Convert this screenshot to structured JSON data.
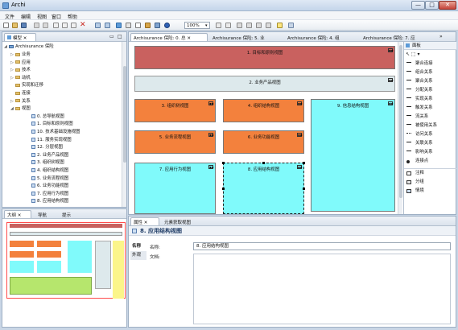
{
  "window": {
    "title": "Archi",
    "min_label": "—",
    "max_label": "□",
    "close_label": "✕"
  },
  "menu": [
    "文件",
    "编辑",
    "视图",
    "窗口",
    "帮助"
  ],
  "toolbar": {
    "zoom": "100%"
  },
  "model_tree": {
    "tab": "模型",
    "root": "Archisurance 保险",
    "folders": [
      "业务",
      "应用",
      "技术",
      "动机",
      "实现和迁移",
      "连接",
      "关系",
      "视图"
    ],
    "views": [
      "0. 总导航视图",
      "1. 目标和原则视图",
      "10. 技术基础设施视图",
      "11. 服务实现视图",
      "12. 分层视图",
      "2. 业务产品视图",
      "3. 组织树视图",
      "4. 组织结构视图",
      "5. 业务流程视图",
      "6. 业务功能视图",
      "7. 应用行为视图",
      "8. 应用结构视图"
    ]
  },
  "editor": {
    "tabs": [
      "Archisurance 保险: 0. 总",
      "Archisurance 保险: 5. 业",
      "Archisurance 保险: 4. 组",
      "Archisurance 保险: 7. 应"
    ],
    "diagram": {
      "n1": "1. 目标和原则视图",
      "n2": "2. 业务产品视图",
      "n3": "3. 组织树视图",
      "n4": "4. 组织结构视图",
      "n5": "5. 业务流程视图",
      "n6": "6. 业务功能视图",
      "n7": "7. 应用行为视图",
      "n8": "8. 应用结构视图",
      "n9": "9. 信息结构视图"
    },
    "colors": {
      "goal": "#c9615f",
      "product": "#dde9ec",
      "org": "#f3813d",
      "app": "#80fafb",
      "selected_border": "#222222"
    }
  },
  "palette": {
    "title": "面板",
    "items": [
      "聚合连接",
      "组合关系",
      "聚合关系",
      "分配关系",
      "实现关系",
      "触发关系",
      "流关系",
      "被使用关系",
      "访问关系",
      "关联关系",
      "影响关系",
      "连接点"
    ],
    "extra": [
      "注释",
      "分组",
      "情境"
    ]
  },
  "outline": {
    "tabs": [
      "大纲",
      "导航",
      "提示"
    ]
  },
  "properties": {
    "tabs": [
      "属性",
      "元素获取视图"
    ],
    "title": "8. 应用结构视图",
    "side_tabs": [
      "名称",
      "外观"
    ],
    "name_label": "名称:",
    "name_value": "8. 应用结构视图",
    "doc_label": "文档:"
  }
}
